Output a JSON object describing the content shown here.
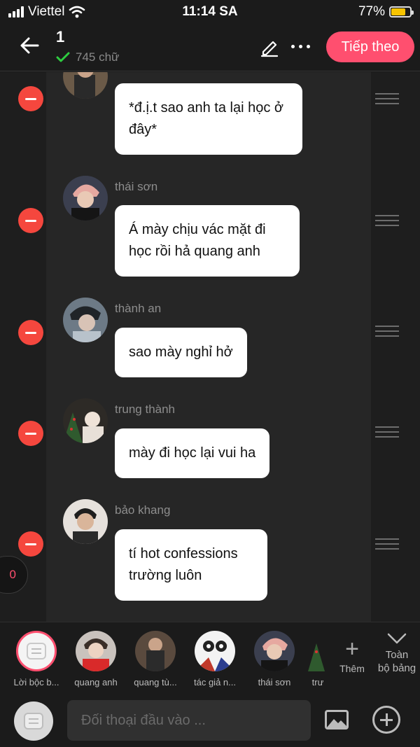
{
  "status_bar": {
    "carrier": "Viettel",
    "time": "11:14 SA",
    "battery": "77%",
    "battery_level": 0.77
  },
  "header": {
    "title": "1",
    "word_count": "745 chữ",
    "next_label": "Tiếp theo"
  },
  "messages": [
    {
      "name": "",
      "text": "*đ.ị.t sao anh ta lại học ở đây*"
    },
    {
      "name": "thái sơn",
      "text": "Á mày chịu vác mặt đi học rồi hả quang anh"
    },
    {
      "name": "thành an",
      "text": "sao mày nghỉ hở"
    },
    {
      "name": "trung thành",
      "text": "mày đi học lại vui ha"
    },
    {
      "name": "bảo khang",
      "text": "tí hot confessions trường luôn"
    }
  ],
  "floating_counter": "0",
  "characters": [
    {
      "label": "Lời bộc b...",
      "icon": "narration-icon"
    },
    {
      "label": "quang anh",
      "icon": "avatar"
    },
    {
      "label": "quang tù...",
      "icon": "avatar"
    },
    {
      "label": "tác giả n...",
      "icon": "avatar"
    },
    {
      "label": "thái sơn",
      "icon": "avatar"
    },
    {
      "label": "trư",
      "icon": "avatar"
    }
  ],
  "char_bar": {
    "add_label": "Thêm",
    "all_label_1": "Toàn",
    "all_label_2": "bộ bảng"
  },
  "input": {
    "placeholder": "Đối thoại đầu vào ..."
  },
  "colors": {
    "accent": "#ff4f6f",
    "delete": "#f5473e",
    "background": "#1b1b1b",
    "bubble": "#ffffff"
  }
}
